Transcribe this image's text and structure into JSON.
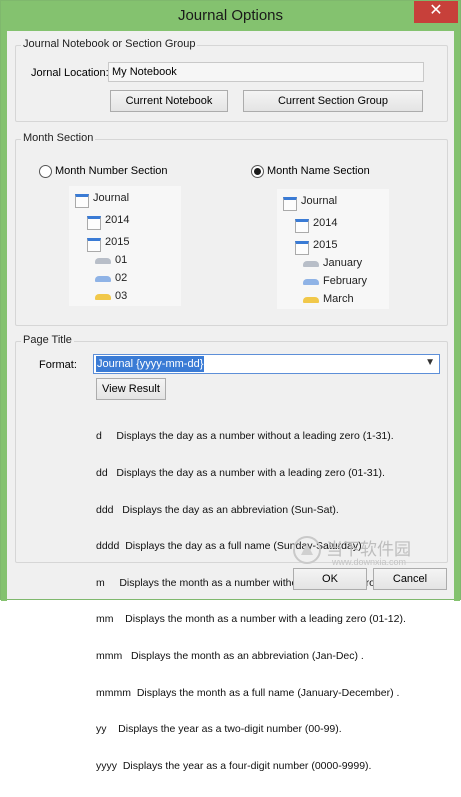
{
  "window": {
    "title": "Journal Options",
    "close_glyph": "✕"
  },
  "notebook_group": {
    "legend": "Journal Notebook or Section Group",
    "location_label": "Jornal Location:",
    "location_value": "My Notebook",
    "current_notebook_label": "Current Notebook",
    "current_section_group_label": "Current Section Group"
  },
  "month_section": {
    "legend": "Month Section",
    "number_option_label": "Month Number Section",
    "name_option_label": "Month Name Section",
    "selected": "name",
    "number_tree": [
      "Journal",
      "2014",
      "2015",
      "01",
      "02",
      "03"
    ],
    "name_tree": [
      "Journal",
      "2014",
      "2015",
      "January",
      "February",
      "March"
    ]
  },
  "page_title": {
    "legend": "Page Title",
    "format_label": "Format:",
    "format_value": "Journal {yyyy-mm-dd}",
    "view_result_label": "View Result",
    "description_lines": [
      "d     Displays the day as a number without a leading zero (1-31).",
      "dd   Displays the day as a number with a leading zero (01-31).",
      "ddd   Displays the day as an abbreviation (Sun-Sat).",
      "dddd  Displays the day as a full name (Sunday-Saturday).",
      "m     Displays the month as a number without a leading zero (1-12).",
      "mm    Displays the month as a number with a leading zero (01-12).",
      "mmm   Displays the month as an abbreviation (Jan-Dec) .",
      "mmmm  Displays the month as a full name (January-December) .",
      "yy    Displays the year as a two-digit number (00-99).",
      "yyyy  Displays the year as a four-digit number (0000-9999)."
    ]
  },
  "footer": {
    "ok_label": "OK",
    "cancel_label": "Cancel"
  },
  "watermark": {
    "text": "当下软件园",
    "url": "www.downxia.com"
  },
  "colors": {
    "titlebar": "#84c26f",
    "close": "#c7403a",
    "notebook_tab": "#3a7bd5",
    "section_gray": "#b8bec8",
    "section_blue": "#8fb3e6",
    "section_yellow": "#f1c84a"
  }
}
